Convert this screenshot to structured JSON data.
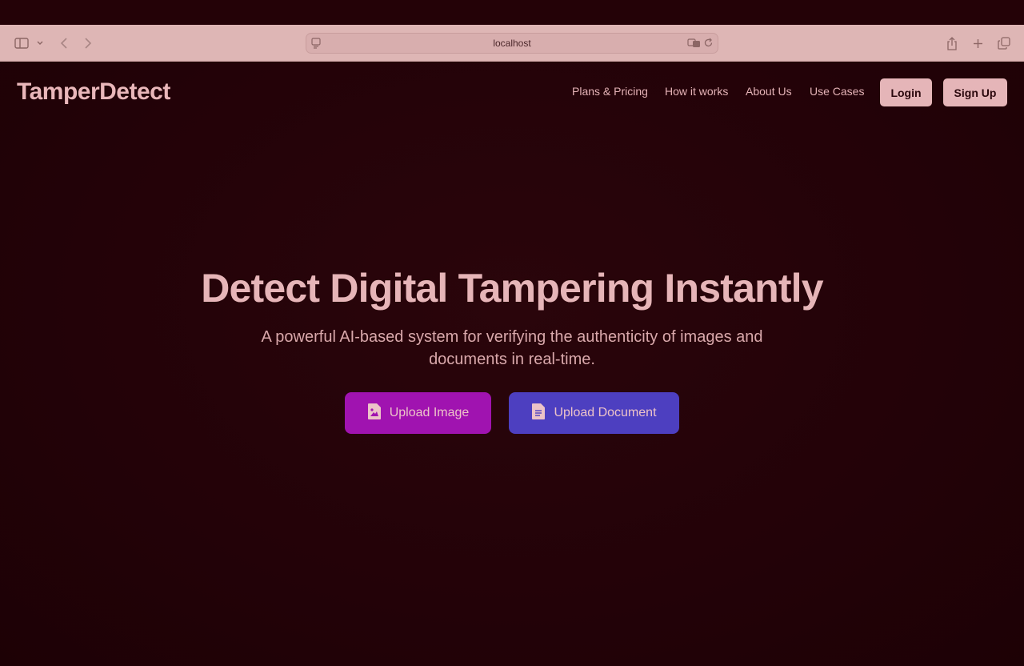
{
  "browser": {
    "url": "localhost",
    "icons": [
      "sidebar-icon",
      "chevron-down-icon",
      "back-icon",
      "forward-icon",
      "page-icon",
      "translate-icon",
      "reload-icon",
      "share-icon",
      "new-tab-icon",
      "tabs-overview-icon"
    ]
  },
  "header": {
    "logo": "TamperDetect",
    "nav": [
      "Plans & Pricing",
      "How it works",
      "About Us",
      "Use Cases"
    ],
    "login": "Login",
    "signup": "Sign Up"
  },
  "hero": {
    "title": "Detect Digital Tampering Instantly",
    "subtitle_line1": "A powerful AI-based system for verifying the authenticity of images and",
    "subtitle_line2": "documents in real-time.",
    "upload_image": "Upload Image",
    "upload_document": "Upload Document"
  },
  "colors": {
    "background": "#240207",
    "browser_bar": "#deb6b5",
    "upload_image_button": "#a013b0",
    "upload_document_button": "#4d3fc0",
    "auth_button": "#e5b5b8"
  }
}
